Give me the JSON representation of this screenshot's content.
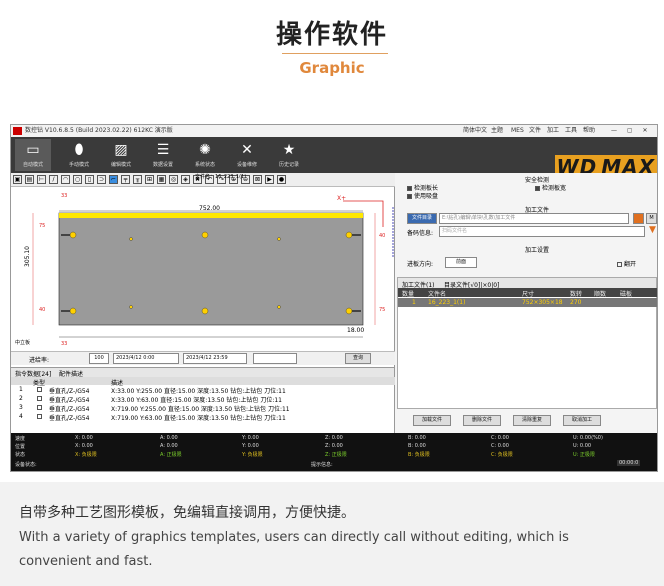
{
  "header": {
    "title": "操作软件",
    "subtitle": "Graphic"
  },
  "app": {
    "title": "数控钻 V10.6.8.5 (Build 2023.02.22) 612KC 演示版",
    "menu": [
      "简体中文",
      "主题",
      "MES",
      "文件",
      "加工",
      "工具",
      "帮助"
    ],
    "toolbar": [
      {
        "label": "自动模式",
        "icon": "monitor-icon"
      },
      {
        "label": "手动模式",
        "icon": "mouse-icon"
      },
      {
        "label": "编辑模式",
        "icon": "edit-icon"
      },
      {
        "label": "数据设置",
        "icon": "list-icon"
      },
      {
        "label": "系统状态",
        "icon": "sun-icon"
      },
      {
        "label": "设备维修",
        "icon": "tools-icon"
      },
      {
        "label": "历史记录",
        "icon": "star-icon"
      }
    ],
    "brand_a": "WD",
    "brand_b": "MAX",
    "file_name": "文件名：16_223_1(1)",
    "dims": {
      "width": "752.00",
      "height": "305.10",
      "thickness": "18.00",
      "left_top": "33",
      "top_dim": "33",
      "d1": "75",
      "d2": "40",
      "d3": "40",
      "d4": "75"
    },
    "axis_x": "X+",
    "origin": "中立板",
    "search": {
      "label": "进给率:",
      "value": "100",
      "date_from": "2023/4/12 0:00",
      "date_to": "2023/4/12 23:59",
      "query": "查询"
    },
    "op_tabs": [
      "指令数据[24]",
      "配件描述"
    ],
    "op_headers": [
      "",
      "类型",
      "描述"
    ],
    "op_rows": [
      {
        "n": "1",
        "type": "垂直孔/Z-/G54",
        "desc": "X:33.00 Y:255.00 直径:15.00 深度:13.50 钻包:上钻包 刀位:11"
      },
      {
        "n": "2",
        "type": "垂直孔/Z-/G54",
        "desc": "X:33.00 Y:63.00 直径:15.00 深度:13.50 钻包:上钻包 刀位:11"
      },
      {
        "n": "3",
        "type": "垂直孔/Z-/G54",
        "desc": "X:719.00 Y:255.00 直径:15.00 深度:13.50 钻包:上钻包 刀位:11"
      },
      {
        "n": "4",
        "type": "垂直孔/Z-/G54",
        "desc": "X:719.00 Y:63.00 直径:15.00 深度:13.50 钻包:上钻包 刀位:11"
      }
    ],
    "safety": {
      "title": "安全检测",
      "c1": "检测板长",
      "c2": "检测板宽",
      "c3": "使用吸盘"
    },
    "filesec": {
      "title": "加工文件",
      "btn": "文件目录",
      "path": "E:\\钻孔\\编辑\\单块\\孔数\\加工文件",
      "info_label": "备码信息:",
      "info_placeholder": "扫码文件名"
    },
    "setting": {
      "title": "加工设置",
      "dir_label": "进板方向:",
      "dir_value": "前面",
      "flip": "翻开"
    },
    "proc_tabs": [
      "加工文件(1)",
      "目录文件[√0]|×0|0]"
    ],
    "proc_headers": [
      "数量",
      "文件名",
      "尺寸",
      "数转",
      "顺数",
      "磁板"
    ],
    "proc_row": {
      "n": "1",
      "file": "16_223_1(1)",
      "size": "752×305×18",
      "rot": "270"
    },
    "proc_buttons": [
      "加载文件",
      "删除文件",
      "清除重复",
      "取消加工"
    ],
    "status": {
      "rows": [
        {
          "h": "速度",
          "c": [
            "X: 0.00",
            "A: 0.00",
            "Y: 0.00",
            "Z: 0.00",
            "B: 0.00",
            "C: 0.00",
            "U: 0.00(%0)"
          ]
        },
        {
          "h": "位置",
          "c": [
            "X: 0.00",
            "A: 0.00",
            "Y: 0.00",
            "Z: 0.00",
            "B: 0.00",
            "C: 0.00",
            "U: 0.00"
          ]
        },
        {
          "h": "状态",
          "c": [
            "X: 负极限",
            "A: 正极限",
            "Y: 负极限",
            "Z: 正极限",
            "B: 负极限",
            "C: 负极限",
            "U: 正极限"
          ]
        }
      ],
      "device": "设备状态:",
      "tip": "提示信息:",
      "clock": "00:00:0"
    }
  },
  "desc": {
    "cn": "自带多种工艺图形模板，免编辑直接调用，方便快捷。",
    "en": "With a variety of graphics templates, users can directly call without editing, which is convenient and fast."
  },
  "colors": {
    "accent": "#e0883c",
    "status_ok": "#7ccf2c",
    "status_err": "#e0c020"
  }
}
